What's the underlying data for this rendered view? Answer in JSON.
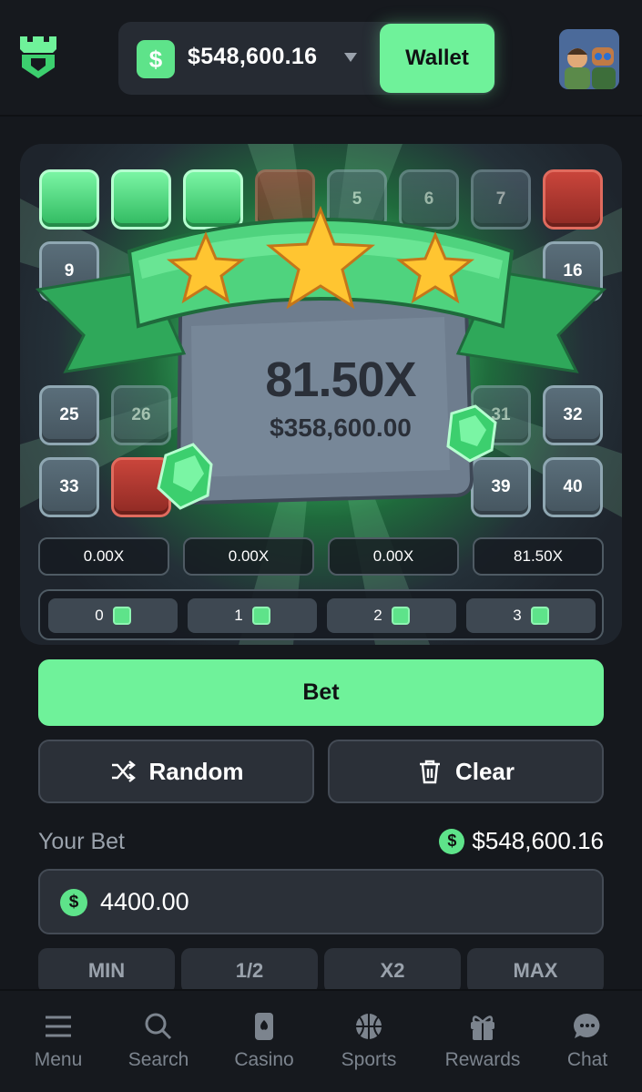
{
  "header": {
    "balance": "$548,600.16",
    "currency_symbol": "$",
    "wallet_label": "Wallet"
  },
  "board": {
    "tiles": [
      {
        "label": "",
        "state": "gem"
      },
      {
        "label": "",
        "state": "gem"
      },
      {
        "label": "",
        "state": "gem"
      },
      {
        "label": "",
        "state": "red-faded"
      },
      {
        "label": "5",
        "state": "faded"
      },
      {
        "label": "6",
        "state": "faded"
      },
      {
        "label": "7",
        "state": "faded"
      },
      {
        "label": "",
        "state": "red"
      },
      {
        "label": "9",
        "state": "normal"
      },
      {
        "label": "16",
        "state": "normal"
      },
      {
        "label": "25",
        "state": "normal"
      },
      {
        "label": "26",
        "state": "faded"
      },
      {
        "label": "31",
        "state": "faded"
      },
      {
        "label": "32",
        "state": "normal"
      },
      {
        "label": "33",
        "state": "normal"
      },
      {
        "label": "",
        "state": "red"
      },
      {
        "label": "39",
        "state": "normal"
      },
      {
        "label": "40",
        "state": "normal"
      }
    ],
    "win": {
      "multiplier": "81.50X",
      "amount": "$358,600.00"
    },
    "multipliers": [
      "0.00X",
      "0.00X",
      "0.00X",
      "81.50X"
    ],
    "gem_counts": [
      "0",
      "1",
      "2",
      "3"
    ]
  },
  "controls": {
    "bet_label": "Bet",
    "random_label": "Random",
    "clear_label": "Clear",
    "your_bet_label": "Your Bet",
    "your_bet_balance": "$548,600.16",
    "bet_amount": "4400.00",
    "quick_buttons": [
      "MIN",
      "1/2",
      "X2",
      "MAX"
    ]
  },
  "nav": {
    "items": [
      "Menu",
      "Search",
      "Casino",
      "Sports",
      "Rewards",
      "Chat"
    ]
  },
  "colors": {
    "accent": "#6ff29a",
    "background": "#15181d",
    "panel": "#2b3038",
    "muted_text": "#9aa2ac"
  }
}
